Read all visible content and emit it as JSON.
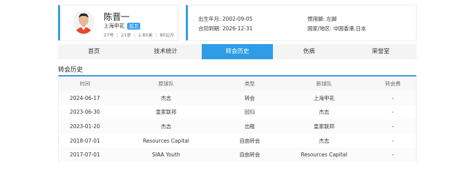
{
  "player": {
    "name": "陈晋一",
    "club": "上海申花",
    "position": "后卫",
    "number": "27号",
    "age": "21岁",
    "height": "1.85米",
    "weight": "80公斤"
  },
  "info": {
    "birth": "出生年月: 2002-09-05",
    "contract": "合同到期: 2026-12-31",
    "foot": "惯用脚: 左脚",
    "nationality": "国家/地区: 中国香港,日本"
  },
  "tabs": [
    "首页",
    "技术统计",
    "转会历史",
    "伤病",
    "荣誉室"
  ],
  "active_tab": "转会历史",
  "section_title": "转会历史",
  "table": {
    "headers": [
      "时间",
      "原球队",
      "类型",
      "新球队",
      "转会费"
    ],
    "rows": [
      [
        "2024-06-17",
        "杰志",
        "转会",
        "上海申花",
        "-"
      ],
      [
        "2023-06-30",
        "皇家联邦",
        "回归",
        "杰志",
        "-"
      ],
      [
        "2023-01-20",
        "杰志",
        "出租",
        "皇家联邦",
        "-"
      ],
      [
        "2018-07-01",
        "Resources Capital",
        "自由转会",
        "杰志",
        "-"
      ],
      [
        "2017-07-01",
        "SIAA Youth",
        "自由转会",
        "Resources Capital",
        "-"
      ]
    ]
  },
  "colors": {
    "accent": "#2e9de6"
  }
}
